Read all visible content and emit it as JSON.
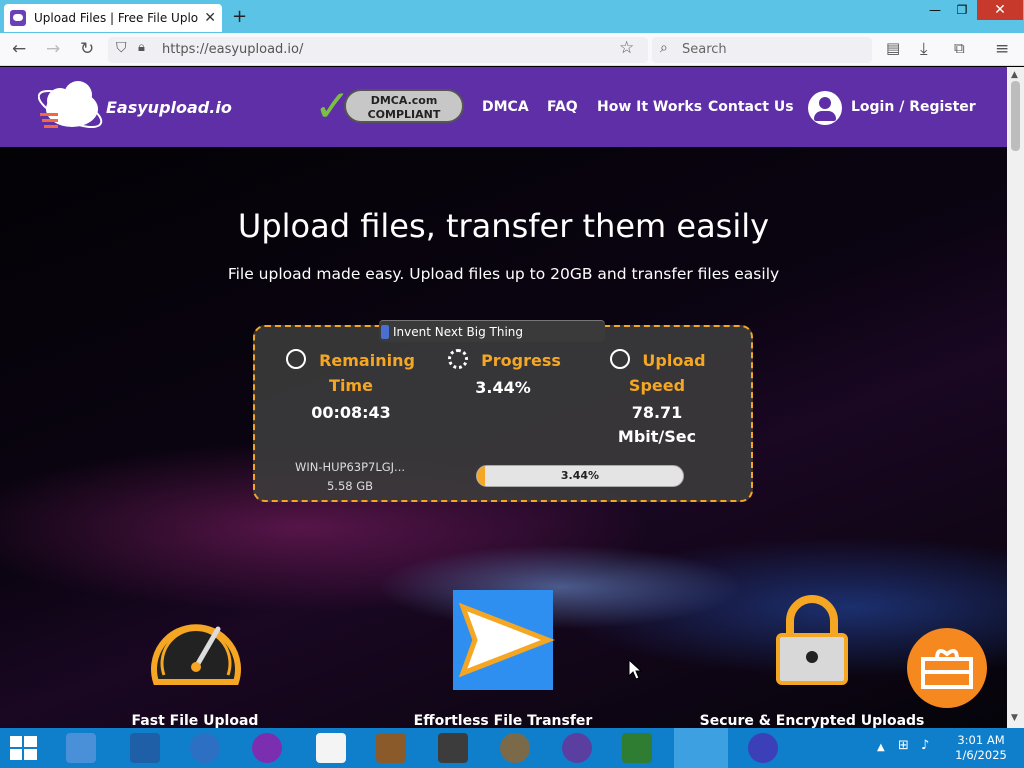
{
  "browser": {
    "tab_title": "Upload Files | Free File Upload a",
    "tab_close": "✕",
    "new_tab": "+",
    "url": "https://easyupload.io/",
    "search_placeholder": "Search",
    "window_controls": [
      "—",
      "❐",
      "✕"
    ]
  },
  "site": {
    "logo": "Easyupload.io",
    "dmca_badge": "DMCA.com COMPLIANT",
    "nav": [
      "DMCA",
      "FAQ",
      "How It Works",
      "Contact Us"
    ],
    "login": "Login / Register"
  },
  "hero": {
    "title": "Upload files, transfer them easily",
    "subtitle": "File upload made easy. Upload files up to 20GB and transfer files easily"
  },
  "upload": {
    "tooltip": "Invent Next Big Thing",
    "remaining_label_1": "Remaining",
    "remaining_label_2": "Time",
    "remaining_value": "00:08:43",
    "progress_label": "Progress",
    "progress_value": "3.44%",
    "speed_label_1": "Upload",
    "speed_label_2": "Speed",
    "speed_value_1": "78.71",
    "speed_value_2": "Mbit/Sec",
    "file_name": "WIN-HUP63P7LGJ...",
    "file_size": "5.58 GB",
    "bar_text": "3.44%",
    "bar_fraction": 0.0344
  },
  "features": [
    "Fast File Upload",
    "Effortless File Transfer",
    "Secure & Encrypted Uploads"
  ],
  "taskbar": {
    "time": "3:01 AM",
    "date": "1/6/2025"
  },
  "colors": {
    "accent": "#f5a623",
    "header": "#5e2fa6",
    "taskbar": "#0f7fcc"
  }
}
